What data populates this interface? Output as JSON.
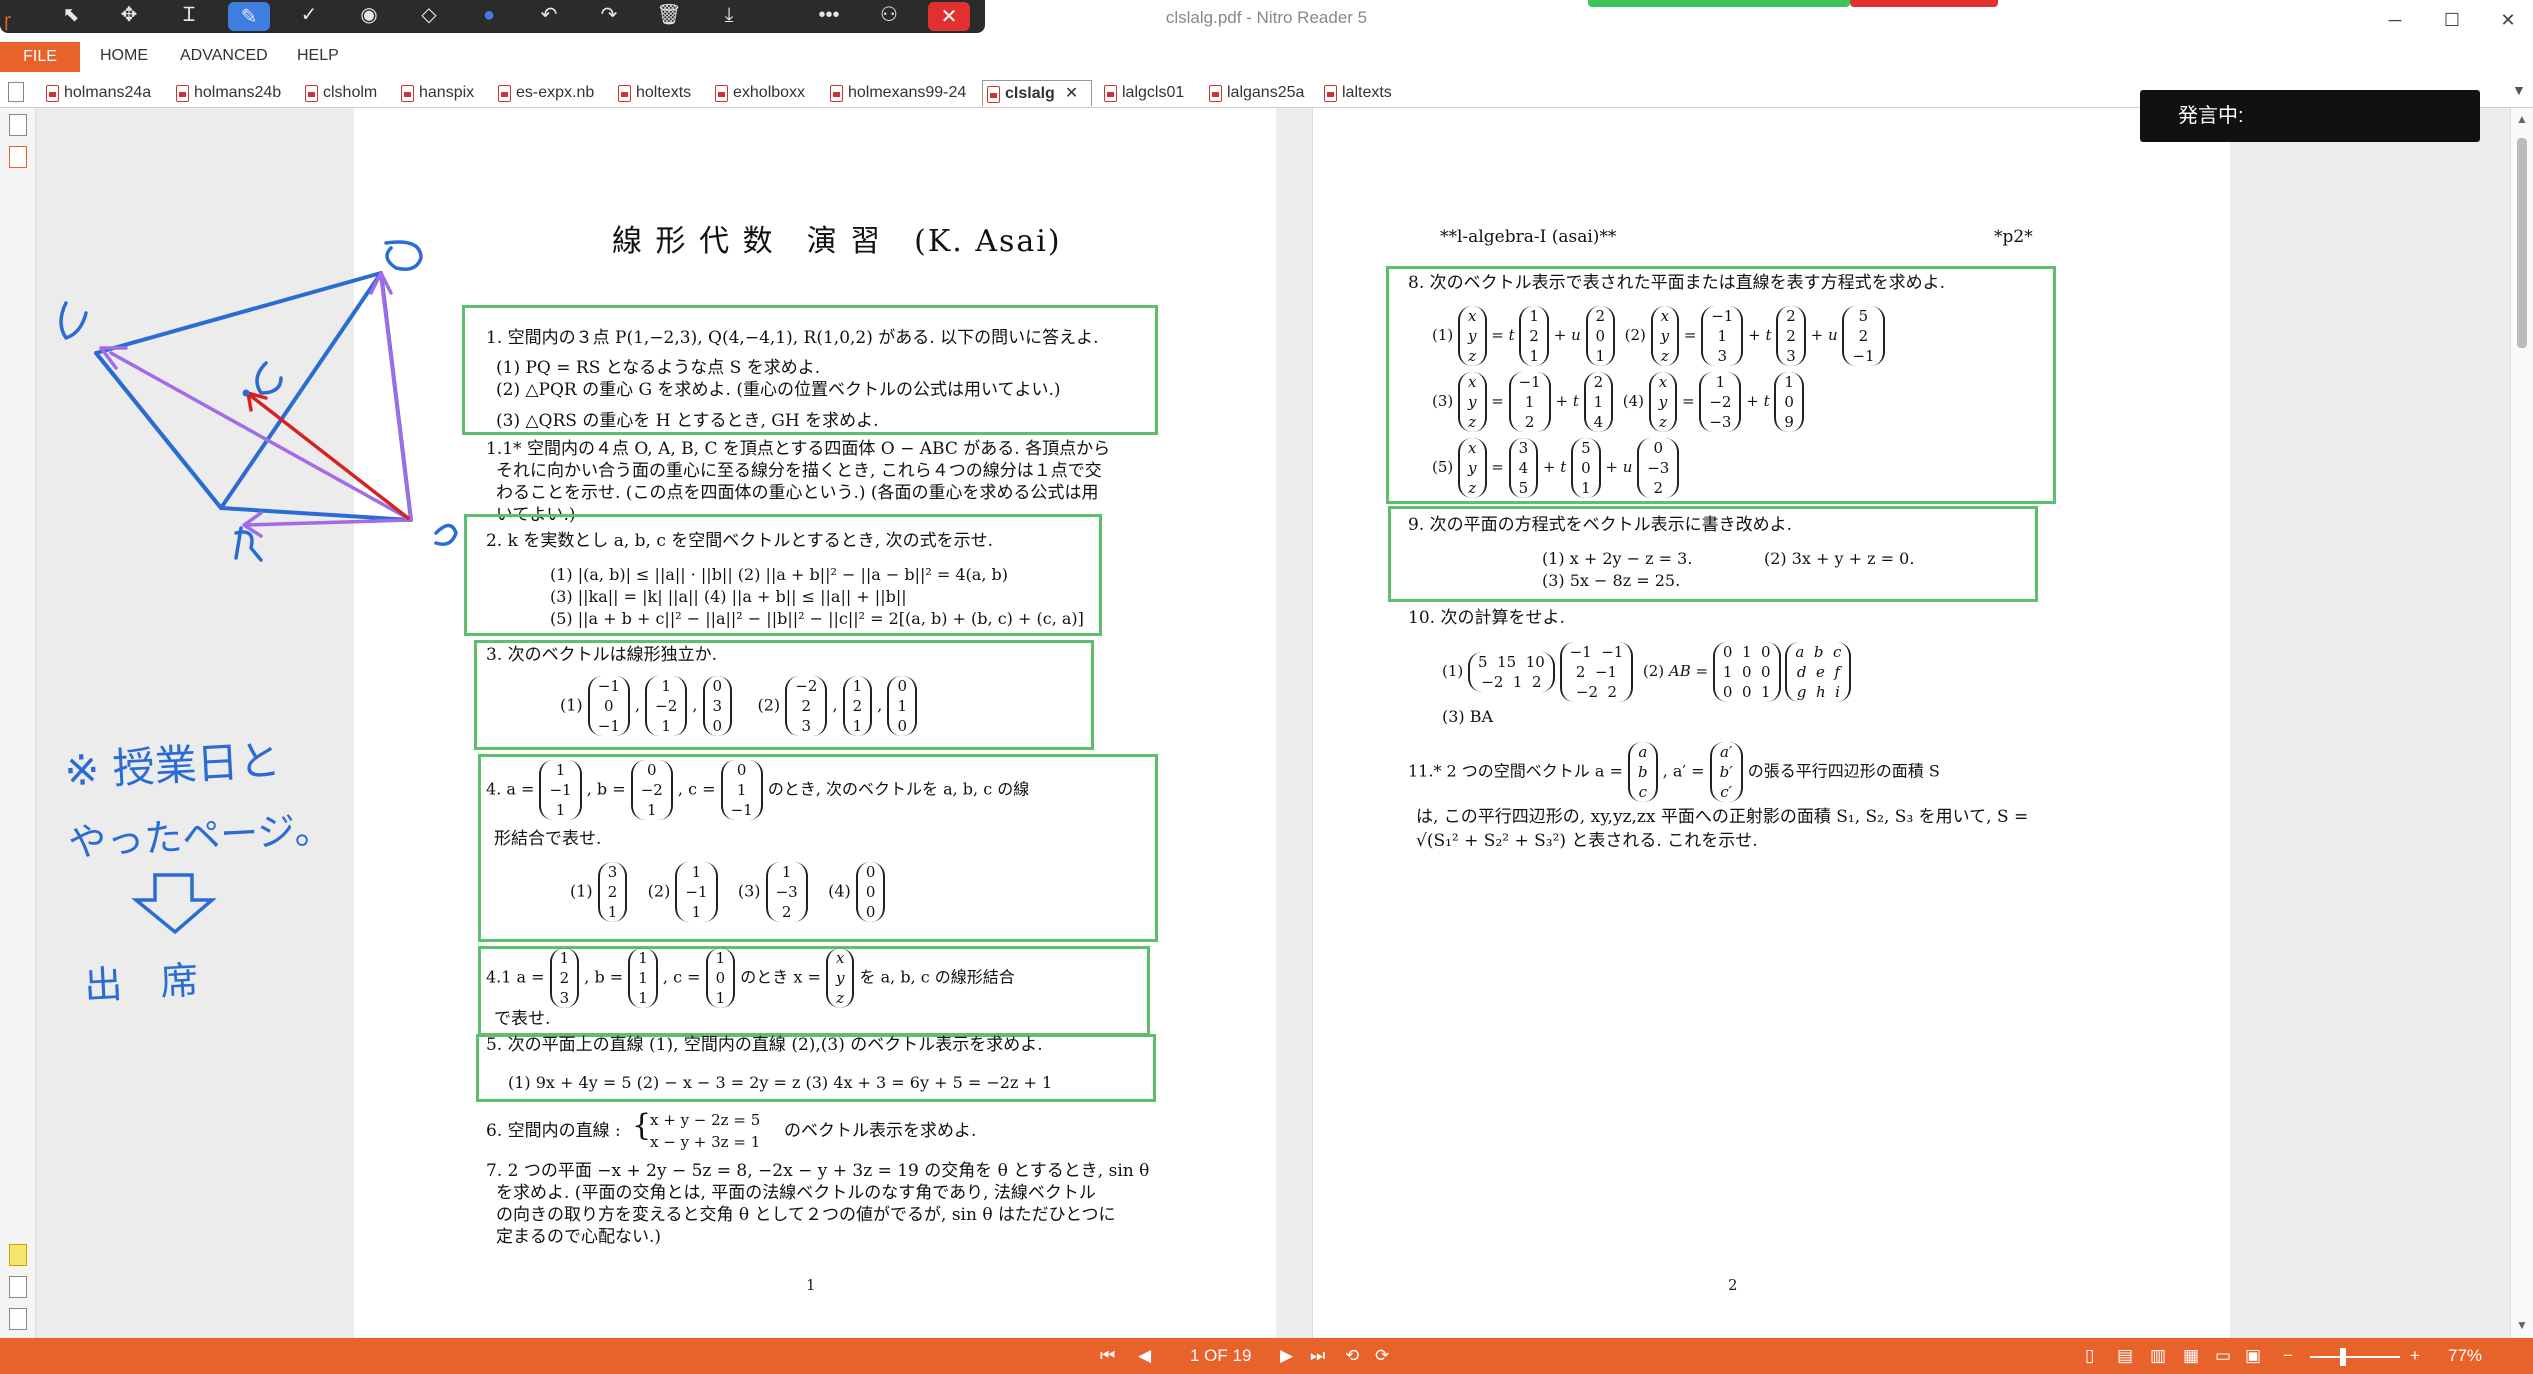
{
  "window": {
    "title": "clslalg.pdf - Nitro Reader 5"
  },
  "colors": {
    "accent": "#e8632b",
    "ink_blue": "#2b6cd4",
    "ink_red": "#d82020",
    "ink_purple": "#a26be8",
    "box_green": "#5fbf6f"
  },
  "ink_toolbar": {
    "icons": [
      "cursor-icon",
      "move-icon",
      "text-cursor-icon",
      "pen-icon",
      "check-icon",
      "stamp-icon",
      "eraser-icon",
      "color-dot-icon",
      "undo-icon",
      "redo-icon",
      "trash-icon",
      "download-icon",
      "more-icon",
      "profile-icon",
      "close-icon"
    ]
  },
  "menu": {
    "file": "FILE",
    "home": "HOME",
    "advanced": "ADVANCED",
    "help": "HELP"
  },
  "tabs": [
    "holmans24a",
    "holmans24b",
    "clsholm",
    "hanspix",
    "es-expx.nb",
    "holtexts",
    "exholboxx",
    "holmexans99-24",
    "clslalg",
    "lalgcls01",
    "lalgans25a",
    "laltexts"
  ],
  "active_tab": "clslalg",
  "speaking_label": "発言中:",
  "page1": {
    "title": "線 形 代 数　演 習　(K. Asai)",
    "q1": "1. 空間内の３点 P(1,−2,3), Q(4,−4,1), R(1,0,2) がある. 以下の問いに答えよ.",
    "q1_1": "(1) PQ = RS となるような点 S を求めよ.",
    "q1_2": "(2) △PQR の重心 G を求めよ. (重心の位置ベクトルの公式は用いてよい.)",
    "q1_3": "(3) △QRS の重心を H とするとき, GH を求めよ.",
    "q1_1star_a": "1.1* 空間内の４点 O, A, B, C を頂点とする四面体 O − ABC がある. 各頂点から",
    "q1_1star_b": "それに向かい合う面の重心に至る線分を描くとき, これら４つの線分は１点で交",
    "q1_1star_c": "わることを示せ. (この点を四面体の重心という.) (各面の重心を求める公式は用",
    "q1_1star_d": "いてよい.)",
    "q2": "2. k を実数とし a, b, c を空間ベクトルとするとき, 次の式を示せ.",
    "q2_r1": "(1) |(a, b)| ≤ ||a|| · ||b||       (2) ||a + b||² − ||a − b||² = 4(a, b)",
    "q2_r2": "(3) ||ka|| = |k| ||a||               (4) ||a + b|| ≤ ||a|| + ||b||",
    "q2_r3": "(5) ||a + b + c||² − ||a||² − ||b||² − ||c||² = 2[(a, b) + (b, c) + (c, a)]",
    "q3": "3. 次のベクトルは線形独立か.",
    "q4_a": "4. a =",
    "q4_b": "のとき, 次のベクトルを a, b, c の線",
    "q4_c": "形結合で表せ.",
    "q41_a": "4.1 a =",
    "q41_b": "のとき x =",
    "q41_c": "を a, b, c の線形結合",
    "q41_d": "で表せ.",
    "q5": "5. 次の平面上の直線 (1), 空間内の直線 (2),(3) のベクトル表示を求めよ.",
    "q5_parts": "(1) 9x + 4y = 5      (2) − x − 3 = 2y = z      (3) 4x + 3 = 6y + 5 = −2z + 1",
    "q6_a": "6. 空間内の直線 :",
    "q6_eq1": "x + y − 2z = 5",
    "q6_eq2": "x − y + 3z = 1",
    "q6_b": "のベクトル表示を求めよ.",
    "q7_a": "7. 2 つの平面 −x + 2y − 5z = 8, −2x − y + 3z = 19 の交角を θ とするとき, sin θ",
    "q7_b": "を求めよ. (平面の交角とは, 平面の法線ベクトルのなす角であり, 法線ベクトル",
    "q7_c": "の向きの取り方を変えると交角 θ として２つの値がでるが, sin θ はただひとつに",
    "q7_d": "定まるので心配ない.)",
    "page_number": "1"
  },
  "page2": {
    "header_left": "**l-algebra-I (asai)**",
    "header_right": "*p2*",
    "q8": "8. 次のベクトル表示で表された平面または直線を表す方程式を求めよ.",
    "q9": "9. 次の平面の方程式をベクトル表示に書き改めよ.",
    "q9_1": "(1) x + 2y − z = 3.",
    "q9_2": "(2) 3x + y + z = 0.",
    "q9_3": "(3) 5x − 8z = 25.",
    "q10": "10. 次の計算をせよ.",
    "q10_3": "(3) BA",
    "q11_a": "11.* 2 つの空間ベクトル a =",
    "q11_b": ", a′ =",
    "q11_c": "の張る平行四辺形の面積 S",
    "q11_d": "は, この平行四辺形の, xy,yz,zx 平面への正射影の面積 S₁, S₂, S₃ を用いて, S =",
    "q11_e": "√(S₁² + S₂² + S₃²) と表される. これを示せ.",
    "page_number": "2"
  },
  "handwriting": {
    "line1": "※ 授業日と",
    "line2": "やったページ。",
    "line3": "出　席"
  },
  "status": {
    "page_indicator": "1 OF 19",
    "zoom": "77%"
  }
}
